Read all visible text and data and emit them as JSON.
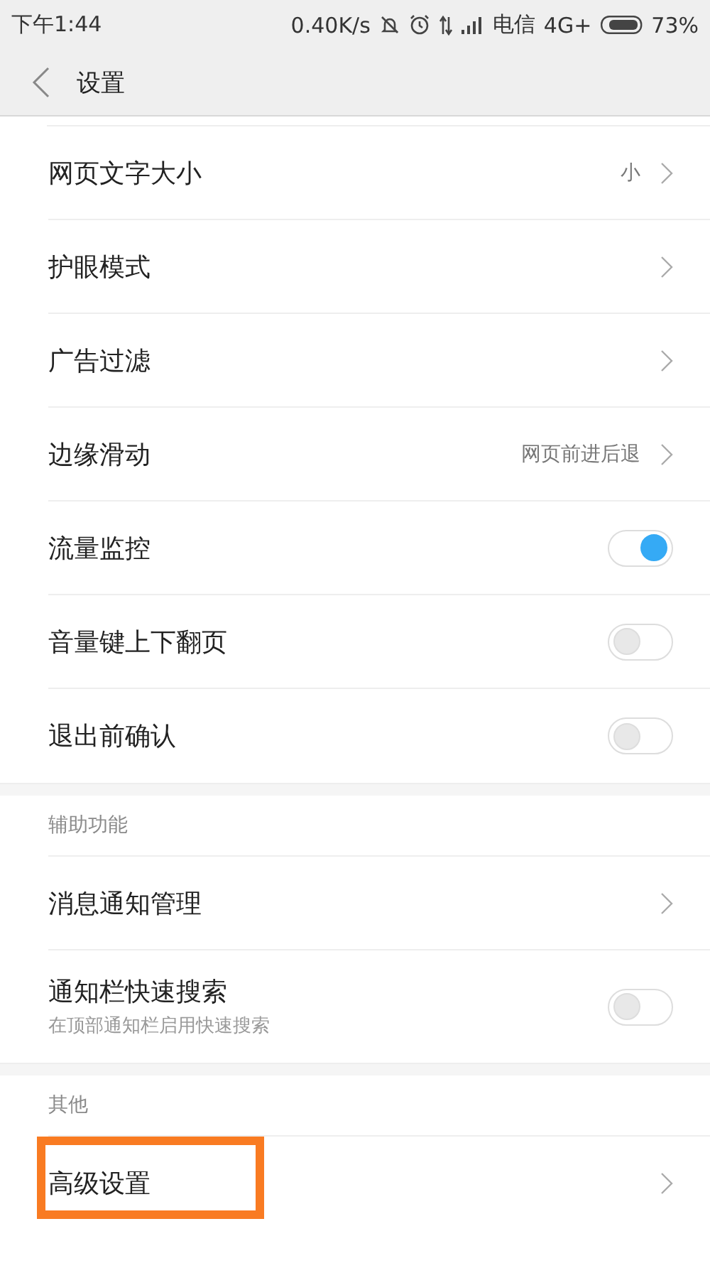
{
  "status_bar": {
    "time": "下午1:44",
    "speed": "0.40K/s",
    "carrier": "电信",
    "network": "4G+",
    "battery": "73%"
  },
  "header": {
    "title": "设置"
  },
  "sections": [
    {
      "items": [
        {
          "kind": "link",
          "label": "网页文字大小",
          "value": "小"
        },
        {
          "kind": "link",
          "label": "护眼模式"
        },
        {
          "kind": "link",
          "label": "广告过滤"
        },
        {
          "kind": "link",
          "label": "边缘滑动",
          "value": "网页前进后退"
        },
        {
          "kind": "toggle",
          "label": "流量监控",
          "on": true
        },
        {
          "kind": "toggle",
          "label": "音量键上下翻页",
          "on": false
        },
        {
          "kind": "toggle",
          "label": "退出前确认",
          "on": false
        }
      ]
    },
    {
      "header": "辅助功能",
      "items": [
        {
          "kind": "link",
          "label": "消息通知管理"
        },
        {
          "kind": "toggle",
          "label": "通知栏快速搜索",
          "subtitle": "在顶部通知栏启用快速搜索",
          "on": false
        }
      ]
    },
    {
      "header": "其他",
      "items": [
        {
          "kind": "link",
          "label": "高级设置",
          "highlighted": true
        }
      ]
    }
  ]
}
